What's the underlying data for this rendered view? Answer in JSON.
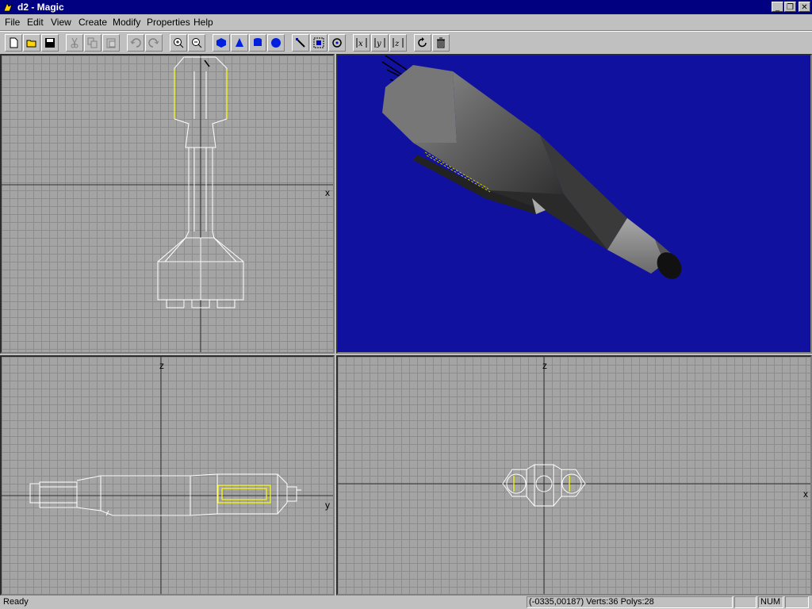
{
  "window": {
    "title": "d2 - Magic",
    "controls": [
      "_",
      "❐",
      "✕"
    ]
  },
  "menu": [
    "File",
    "Edit",
    "View",
    "Create",
    "Modify",
    "Properties",
    "Help"
  ],
  "toolbar": {
    "buttons": [
      "new-file-icon",
      "open-folder-icon",
      "save-disk-icon",
      "cut-icon",
      "copy-icon",
      "paste-icon",
      "undo-icon",
      "redo-icon",
      "zoom-in-icon",
      "zoom-out-icon",
      "cube-shape-icon",
      "cone-shape-icon",
      "cylinder-shape-icon",
      "sphere-shape-icon",
      "select-icon",
      "select-region-icon",
      "rotate-view-icon",
      "mirror-x-icon",
      "mirror-y-icon",
      "mirror-z-icon",
      "refresh-icon",
      "trash-icon"
    ]
  },
  "viewports": {
    "top": {
      "axis_labels": [
        "x"
      ]
    },
    "side": {
      "axis_labels": [
        "z",
        "y"
      ]
    },
    "front": {
      "axis_labels": [
        "z",
        "x"
      ]
    },
    "render": {
      "background": "#1111a0"
    }
  },
  "status": {
    "message": "Ready",
    "coords": "(-0335,00187)",
    "stats": "Verts:36 Polys:28",
    "num": "NUM"
  }
}
